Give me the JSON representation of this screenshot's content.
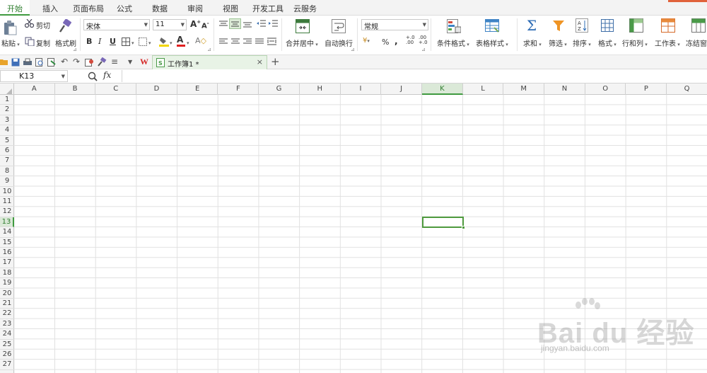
{
  "menu": {
    "tabs": [
      {
        "label": "开始",
        "active": true
      },
      {
        "label": "插入"
      },
      {
        "label": "页面布局"
      },
      {
        "label": "公式"
      },
      {
        "label": "数据"
      },
      {
        "label": "审阅"
      },
      {
        "label": "视图"
      },
      {
        "label": "开发工具"
      },
      {
        "label": "云服务"
      }
    ]
  },
  "ribbon": {
    "paste": "粘贴",
    "cut": "剪切",
    "copy": "复制",
    "format_painter": "格式刷",
    "font_name": "宋体",
    "font_size": "11",
    "bold": "B",
    "italic": "I",
    "underline": "U",
    "merge_center": "合并居中",
    "wrap_text": "自动换行",
    "number_format": "常规",
    "percent": "%",
    "thousands": ",",
    "conditional_format": "条件格式",
    "table_style": "表格样式",
    "sum": "求和",
    "filter": "筛选",
    "sort": "排序",
    "format": "格式",
    "rows_cols": "行和列",
    "worksheet": "工作表",
    "freeze": "冻结窗"
  },
  "document": {
    "tab_label": "工作簿1 *",
    "close": "×",
    "new_tab": "+"
  },
  "formula_bar": {
    "name_box": "K13",
    "fx": "fx",
    "value": ""
  },
  "sheet": {
    "columns": [
      "A",
      "B",
      "C",
      "D",
      "E",
      "F",
      "G",
      "H",
      "I",
      "J",
      "K",
      "L",
      "M",
      "N",
      "O",
      "P",
      "Q"
    ],
    "rows": [
      "1",
      "2",
      "3",
      "4",
      "5",
      "6",
      "7",
      "8",
      "9",
      "10",
      "11",
      "12",
      "13",
      "14",
      "15",
      "16",
      "17",
      "18",
      "19",
      "20",
      "21",
      "22",
      "23",
      "24",
      "25",
      "26",
      "27"
    ],
    "selected_column": "K",
    "selected_row": "13"
  },
  "watermark": {
    "brand": "Bai du 经验",
    "url": "jingyan.baidu.com"
  },
  "colors": {
    "accent_green": "#3f9a3f",
    "selection": "#4f9a3e",
    "header_bg": "#f4f4f4"
  }
}
